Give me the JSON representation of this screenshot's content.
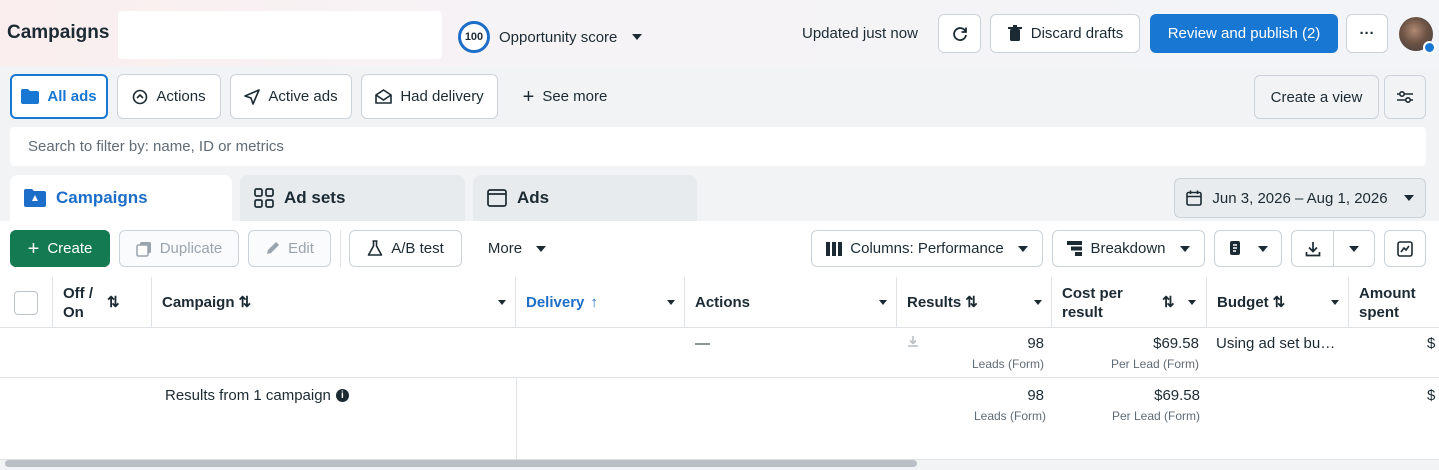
{
  "header": {
    "title": "Campaigns",
    "opportunity_score_value": "100",
    "opportunity_score_label": "Opportunity score",
    "updated": "Updated just now",
    "discard_label": "Discard drafts",
    "publish_label": "Review and publish (2)",
    "more_label": "···"
  },
  "filters": {
    "all_ads": "All ads",
    "actions": "Actions",
    "active_ads": "Active ads",
    "had_delivery": "Had delivery",
    "see_more": "See more",
    "create_view": "Create a view"
  },
  "search": {
    "placeholder": "Search to filter by: name, ID or metrics"
  },
  "tabs": [
    {
      "label": "Campaigns"
    },
    {
      "label": "Ad sets"
    },
    {
      "label": "Ads"
    }
  ],
  "date_range": "Jun 3, 2026 – Aug 1, 2026",
  "toolbar": {
    "create": "Create",
    "duplicate": "Duplicate",
    "edit": "Edit",
    "ab_test": "A/B test",
    "more": "More",
    "columns": "Columns: Performance",
    "breakdown": "Breakdown"
  },
  "table": {
    "headers": {
      "off_on": "Off / On",
      "campaign": "Campaign",
      "delivery": "Delivery",
      "actions": "Actions",
      "results": "Results",
      "cost_per_result": "Cost per result",
      "budget": "Budget",
      "amount_spent": "Amount spent"
    },
    "row": {
      "actions": "—",
      "results": "98",
      "results_sub": "Leads (Form)",
      "cost": "$69.58",
      "cost_sub": "Per Lead (Form)",
      "budget": "Using ad set bu…",
      "amount": "$"
    },
    "summary": {
      "label": "Results from 1 campaign",
      "results": "98",
      "results_sub": "Leads (Form)",
      "cost": "$69.58",
      "cost_sub": "Per Lead (Form)",
      "amount": "$"
    }
  },
  "colors": {
    "accent": "#1877d2",
    "create": "#137a51"
  }
}
